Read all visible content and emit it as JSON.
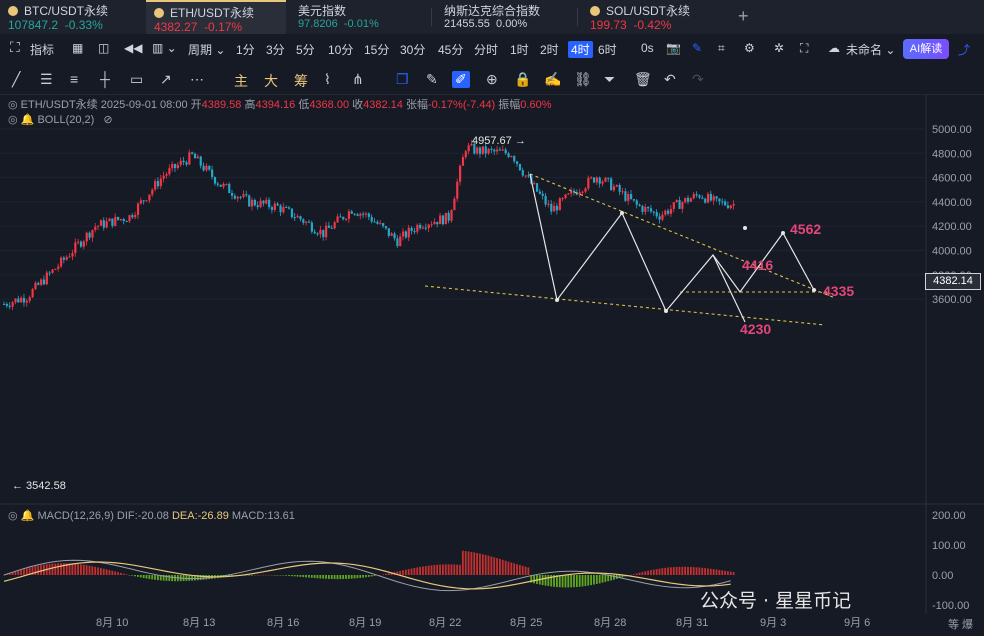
{
  "tabs": [
    {
      "name": "BTC/USDT永续",
      "price": "107847.2",
      "change": "-0.33%",
      "up": false,
      "active": false
    },
    {
      "name": "ETH/USDT永续",
      "price": "4382.27",
      "change": "-0.17%",
      "up": false,
      "active": true
    },
    {
      "name": "美元指数",
      "price": "97.8206",
      "change": "-0.01%",
      "up": false,
      "active": false
    },
    {
      "name": "纳斯达克综合指数",
      "price": "21455.55",
      "change": "0.00%",
      "up": false,
      "active": false
    },
    {
      "name": "SOL/USDT永续",
      "price": "199.73",
      "change": "-0.42%",
      "up": false,
      "active": false
    }
  ],
  "toolbar": {
    "indicator": "指标",
    "period": "周期",
    "intervals": [
      "1分",
      "3分",
      "5分",
      "10分",
      "15分",
      "30分",
      "45分",
      "分时",
      "1时",
      "2时",
      "4时",
      "6时"
    ],
    "selected_interval": "4时",
    "countdown": "0s",
    "layout_name": "未命名",
    "ai_label": "AI解读"
  },
  "drawing_tools": [
    "主",
    "大",
    "筹"
  ],
  "info": {
    "symbol": "ETH/USDT永续",
    "datetime": "2025-09-01 08:00",
    "open_label": "开",
    "open": "4389.58",
    "high_label": "高",
    "high": "4394.16",
    "low_label": "低",
    "low": "4368.00",
    "close_label": "收",
    "close": "4382.14",
    "change_label": "张幅",
    "change": "-0.17%(-7.44)",
    "amp_label": "振幅",
    "amp": "0.60%"
  },
  "boll": "BOLL(20,2)",
  "macd": {
    "label": "MACD(12,26,9)",
    "dif": "DIF:-20.08",
    "dea": "DEA:-26.89",
    "macd": "MACD:13.61"
  },
  "current_price": "4382.14",
  "annotations": {
    "high": "4957.67",
    "low": "3542.58",
    "targets": [
      "4562",
      "4416",
      "4335",
      "4230"
    ]
  },
  "x_labels": [
    "8月 10",
    "8月 13",
    "8月 16",
    "8月 19",
    "8月 22",
    "8月 25",
    "8月 28",
    "8月 31",
    "9月 3",
    "9月 6"
  ],
  "y_labels": [
    "5000.00",
    "4800.00",
    "4600.00",
    "4400.00",
    "4200.00",
    "4000.00",
    "3800.00",
    "3600.00"
  ],
  "macd_y_labels": [
    "200.00",
    "100.00",
    "0.00",
    "-100.00"
  ],
  "watermark": "公众号 · 星星币记",
  "fit_label": "等 爆",
  "colors": {
    "up": "#f23645",
    "down": "#26a6c9",
    "accent": "#2962ff",
    "yellow": "#e8c77b",
    "pink": "#e4457a"
  }
}
